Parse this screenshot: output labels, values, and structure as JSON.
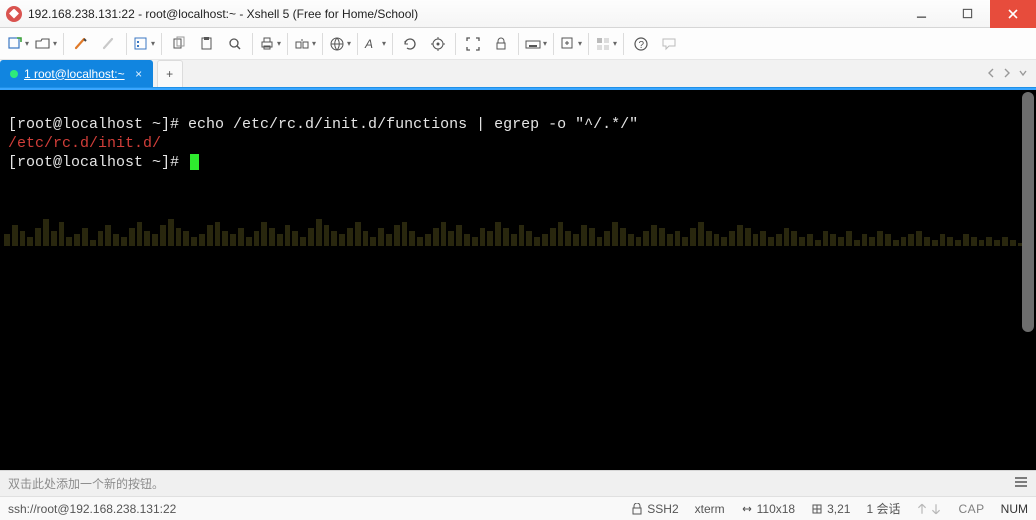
{
  "title": "192.168.238.131:22 - root@localhost:~ - Xshell 5 (Free for Home/School)",
  "tab": {
    "label": "1 root@localhost:~"
  },
  "terminal": {
    "prompt1": "[root@localhost ~]#",
    "cmd1": " echo /etc/rc.d/init.d/functions | egrep -o \"^/.*/\"",
    "output1": "/etc/rc.d/init.d/",
    "prompt2": "[root@localhost ~]# "
  },
  "bottombar": {
    "hint": "双击此处添加一个新的按钮。"
  },
  "status": {
    "conn": "ssh://root@192.168.238.131:22",
    "proto": "SSH2",
    "term": "xterm",
    "size": "110x18",
    "cursor": "3,21",
    "sessions": "1 会话",
    "cap": "CAP",
    "num": "NUM"
  },
  "wave_heights": [
    4,
    7,
    5,
    3,
    6,
    9,
    5,
    8,
    3,
    4,
    6,
    2,
    5,
    7,
    4,
    3,
    6,
    8,
    5,
    4,
    7,
    9,
    6,
    5,
    3,
    4,
    7,
    8,
    5,
    4,
    6,
    3,
    5,
    8,
    6,
    4,
    7,
    5,
    3,
    6,
    9,
    7,
    5,
    4,
    6,
    8,
    5,
    3,
    6,
    4,
    7,
    8,
    5,
    3,
    4,
    6,
    8,
    5,
    7,
    4,
    3,
    6,
    5,
    8,
    6,
    4,
    7,
    5,
    3,
    4,
    6,
    8,
    5,
    4,
    7,
    6,
    3,
    5,
    8,
    6,
    4,
    3,
    5,
    7,
    6,
    4,
    5,
    3,
    6,
    8,
    5,
    4,
    3,
    5,
    7,
    6,
    4,
    5,
    3,
    4,
    6,
    5,
    3,
    4,
    2,
    5,
    4,
    3,
    5,
    2,
    4,
    3,
    5,
    4,
    2,
    3,
    4,
    5,
    3,
    2,
    4,
    3,
    2,
    4,
    3,
    2,
    3,
    2,
    3,
    2,
    1,
    2
  ]
}
